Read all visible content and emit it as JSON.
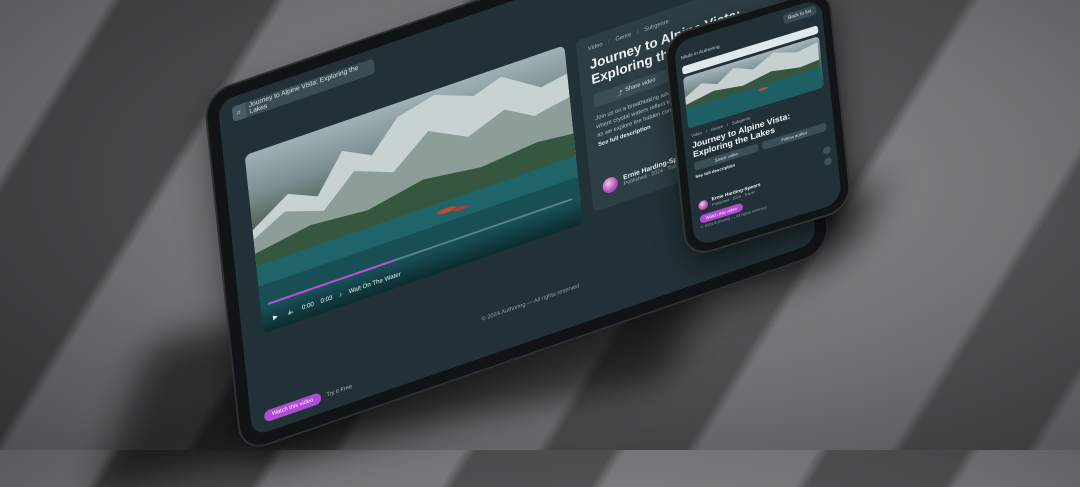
{
  "page": {
    "search_query": "Journey to Alpine Vista: Exploring the Lakes",
    "made_in": "Made in Authoring",
    "back_button": "Back to list",
    "breadcrumbs": [
      "Video",
      "Genre",
      "Subgenre"
    ],
    "title": "Journey to Alpine Vista: Exploring the Lakes",
    "actions": {
      "share": "Share video",
      "follow": "Follow author"
    },
    "description": "Join us on a breathtaking adventure through the Alpine Vista lakes where crystal waters reflect towering peaks. Watch the journey unfold as we explore the hidden corners of this alpine paradise.",
    "see_full": "See full description",
    "author": {
      "name": "Ernie Harding-Spears",
      "subtitle": "Published · 2024 · Travel"
    },
    "player": {
      "current_time": "0:00",
      "duration": "0:03",
      "track_label": "Wait On The Water",
      "progress_pct": 42
    },
    "footer": "© 2024 Authoring — All rights reserved",
    "bottom_bar": {
      "cta": "Watch this video",
      "label": "Try it Free"
    }
  },
  "colors": {
    "accent": "#b04bd6",
    "surface": "#223137",
    "panel": "#2d3e44"
  }
}
